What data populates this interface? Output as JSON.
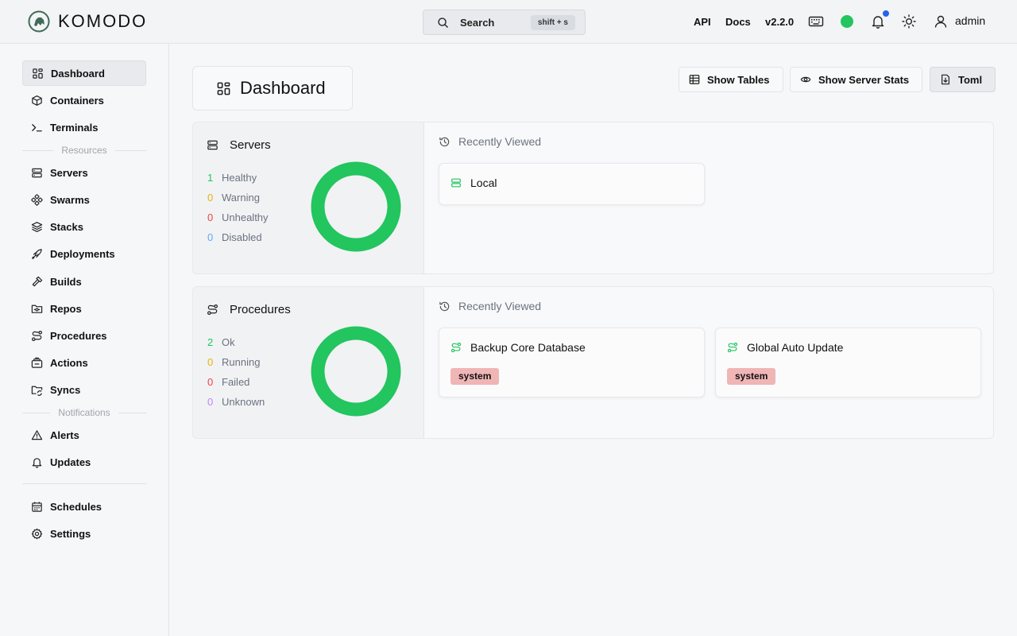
{
  "header": {
    "brand": "KOMODO",
    "search": {
      "label": "Search",
      "shortcut": "shift + s"
    },
    "links": [
      "API",
      "Docs"
    ],
    "version": "v2.2.0",
    "status_color": "#22c55e",
    "notification_color": "#2563eb",
    "user": "admin"
  },
  "sidebar": {
    "top_items": [
      {
        "label": "Dashboard",
        "icon": "dashboard-icon",
        "active": true
      },
      {
        "label": "Containers",
        "icon": "box-icon"
      },
      {
        "label": "Terminals",
        "icon": "terminal-icon"
      }
    ],
    "resources_label": "Resources",
    "resource_items": [
      {
        "label": "Servers",
        "icon": "server-icon"
      },
      {
        "label": "Swarms",
        "icon": "swarm-icon"
      },
      {
        "label": "Stacks",
        "icon": "layers-icon"
      },
      {
        "label": "Deployments",
        "icon": "rocket-icon"
      },
      {
        "label": "Builds",
        "icon": "hammer-icon"
      },
      {
        "label": "Repos",
        "icon": "folder-git-icon"
      },
      {
        "label": "Procedures",
        "icon": "route-icon"
      },
      {
        "label": "Actions",
        "icon": "actions-icon"
      },
      {
        "label": "Syncs",
        "icon": "folder-sync-icon"
      }
    ],
    "notifications_label": "Notifications",
    "notification_items": [
      {
        "label": "Alerts",
        "icon": "alert-triangle-icon"
      },
      {
        "label": "Updates",
        "icon": "bell-icon"
      }
    ],
    "bottom_items": [
      {
        "label": "Schedules",
        "icon": "calendar-icon"
      },
      {
        "label": "Settings",
        "icon": "gear-icon"
      }
    ]
  },
  "main": {
    "title": "Dashboard",
    "actions": [
      {
        "label": "Show Tables",
        "icon": "table-icon"
      },
      {
        "label": "Show Server Stats",
        "icon": "eye-icon"
      },
      {
        "label": "Toml",
        "icon": "file-download-icon"
      }
    ],
    "servers": {
      "title": "Servers",
      "stats": [
        {
          "count": "1",
          "label": "Healthy",
          "color": "#22c55e"
        },
        {
          "count": "0",
          "label": "Warning",
          "color": "#eab308"
        },
        {
          "count": "0",
          "label": "Unhealthy",
          "color": "#ef4444"
        },
        {
          "count": "0",
          "label": "Disabled",
          "color": "#60a5fa"
        }
      ],
      "donut_color": "#22c55e",
      "recent_title": "Recently Viewed",
      "recent": [
        {
          "name": "Local",
          "tag": ""
        }
      ]
    },
    "procedures": {
      "title": "Procedures",
      "stats": [
        {
          "count": "2",
          "label": "Ok",
          "color": "#22c55e"
        },
        {
          "count": "0",
          "label": "Running",
          "color": "#eab308"
        },
        {
          "count": "0",
          "label": "Failed",
          "color": "#ef4444"
        },
        {
          "count": "0",
          "label": "Unknown",
          "color": "#c084fc"
        }
      ],
      "donut_color": "#22c55e",
      "recent_title": "Recently Viewed",
      "recent": [
        {
          "name": "Backup Core Database",
          "tag": "system"
        },
        {
          "name": "Global Auto Update",
          "tag": "system"
        }
      ]
    }
  }
}
